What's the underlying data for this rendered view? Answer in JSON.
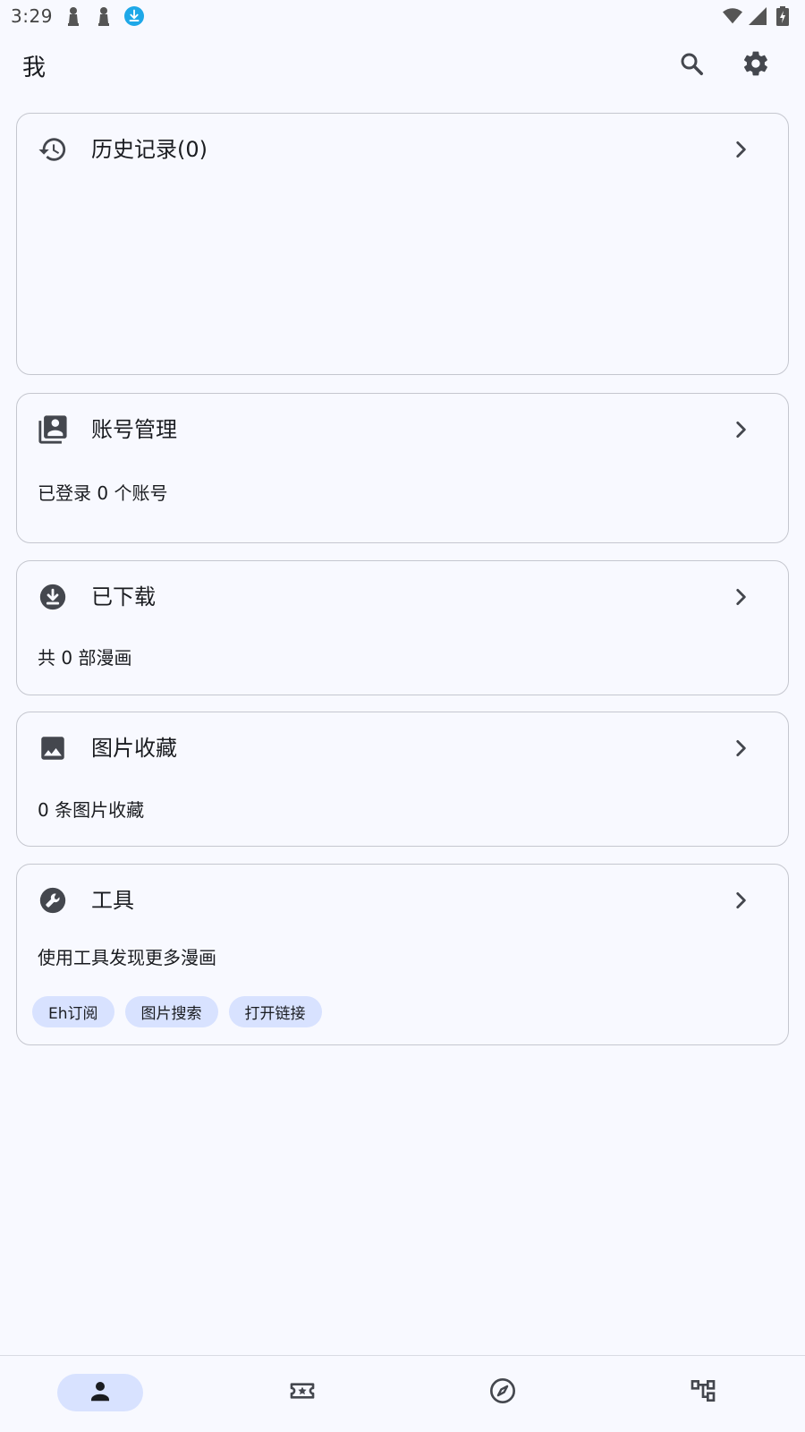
{
  "status_bar": {
    "time": "3:29",
    "icons": [
      "pawn-icon",
      "pawn-icon",
      "download-badge-icon",
      "wifi-icon",
      "signal-icon",
      "battery-charging-icon"
    ]
  },
  "header": {
    "title": "我",
    "actions": [
      "search-icon",
      "settings-icon"
    ]
  },
  "cards": {
    "history": {
      "title": "历史记录(0)",
      "icon": "history-icon"
    },
    "accounts": {
      "title": "账号管理",
      "subtitle": "已登录 0 个账号",
      "icon": "account-box-icon"
    },
    "downloads": {
      "title": "已下载",
      "subtitle": "共 0 部漫画",
      "icon": "download-circle-icon"
    },
    "images": {
      "title": "图片收藏",
      "subtitle": "0 条图片收藏",
      "icon": "image-icon"
    },
    "tools": {
      "title": "工具",
      "subtitle": "使用工具发现更多漫画",
      "icon": "build-circle-icon",
      "chips": [
        "Eh订阅",
        "图片搜索",
        "打开链接"
      ]
    }
  },
  "bottom_nav": {
    "items": [
      "person-icon",
      "local-activity-icon",
      "explore-icon",
      "account-tree-icon"
    ],
    "active_index": 0
  },
  "colors": {
    "background": "#f8f9ff",
    "accent_container": "#d8e2ff",
    "card_border": "#c5c7cf",
    "icon": "#44474e",
    "status_download_badge": "#1ea8e8"
  }
}
